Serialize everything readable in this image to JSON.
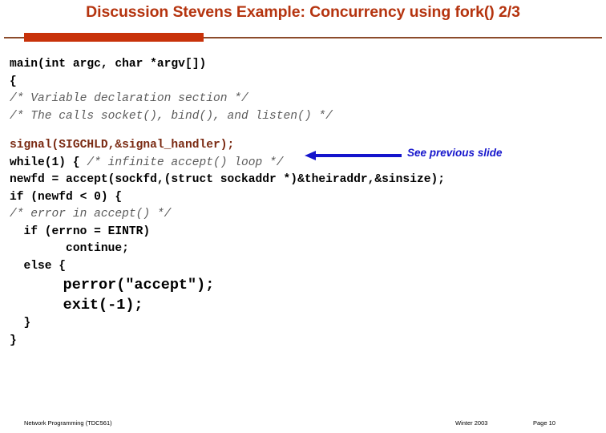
{
  "slide": {
    "title": "Discussion Stevens Example: Concurrency using fork()  2/3",
    "title_color": "#B5340F",
    "rule_thin_color": "#8B4B2B",
    "rule_thick_color": "#C8320A"
  },
  "code": {
    "lines": [
      {
        "text": "main(int argc, char *argv[])",
        "style": "bold"
      },
      {
        "text": "{",
        "style": "bold"
      },
      {
        "text": "/* Variable declaration section */",
        "style": "comment"
      },
      {
        "text": "/* The calls socket(), bind(), and listen() */",
        "style": "comment"
      },
      {
        "text": "signal(SIGCHLD,&signal_handler);",
        "style": "signal"
      },
      {
        "text": "while(1) {",
        "style": "bold",
        "trailing_comment": " /* infinite accept() loop */"
      },
      {
        "text": "newfd = accept(sockfd,(struct sockaddr *)&theiraddr,&sinsize);",
        "style": "bold"
      },
      {
        "text": "if (newfd < 0) {",
        "style": "bold"
      },
      {
        "text": "/* error in accept() */",
        "style": "comment"
      },
      {
        "text": "  if (errno = EINTR)",
        "style": "bold"
      },
      {
        "text": "        continue;",
        "style": "bold"
      },
      {
        "text": "  else {",
        "style": "bold"
      },
      {
        "text": "      perror(\"accept\");",
        "style": "bold-big"
      },
      {
        "text": "      exit(-1);",
        "style": "bold-big"
      },
      {
        "text": "  }",
        "style": "bold"
      },
      {
        "text": "}",
        "style": "bold"
      }
    ]
  },
  "annotation": {
    "label": "See previous slide",
    "color": "#1515CC",
    "icon": "left-arrow-icon"
  },
  "footer": {
    "left": "Network Programming (TDC561)",
    "center": "Winter  2003",
    "right": "Page 10"
  }
}
